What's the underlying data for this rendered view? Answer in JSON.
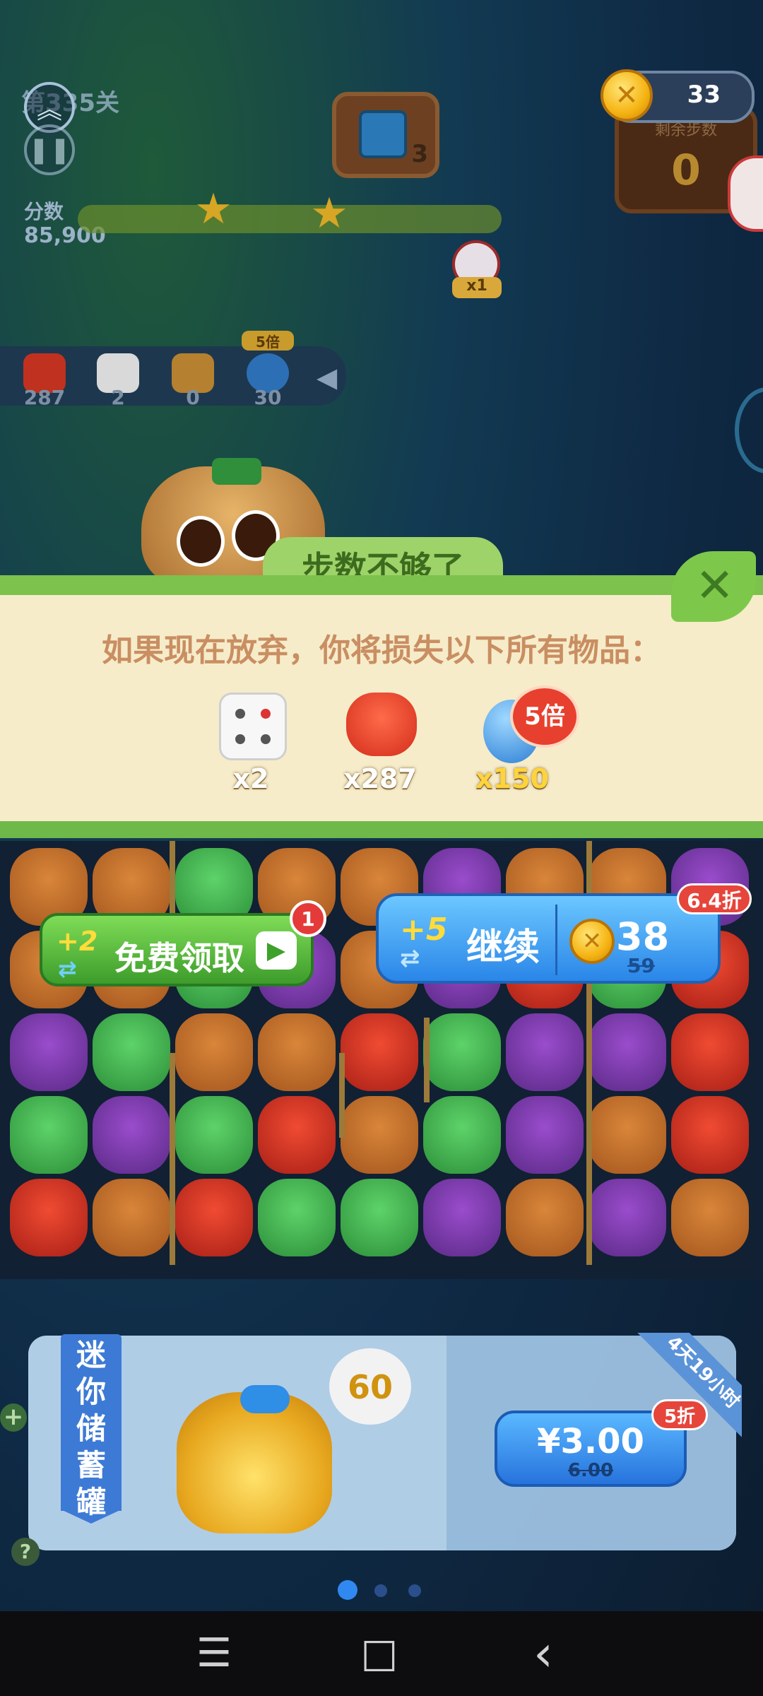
{
  "hud": {
    "level_text": "第335关",
    "score_label": "分数",
    "score_value": "85,900",
    "goal_count": "3",
    "coins": "33",
    "steps_label": "剩余步数",
    "steps_value": "0",
    "alarm_badge": "x1"
  },
  "boosters": [
    {
      "name": "fox-booster",
      "count": "287"
    },
    {
      "name": "dice-booster",
      "count": "2"
    },
    {
      "name": "bag-booster",
      "count": "0"
    },
    {
      "name": "drop-booster",
      "count": "30",
      "badge": "5倍"
    }
  ],
  "dialog": {
    "title": "步数不够了",
    "message": "如果现在放弃，你将损失以下所有物品：",
    "rewards": [
      {
        "icon": "dice-icon",
        "count": "x2"
      },
      {
        "icon": "fox-icon",
        "count": "x287"
      },
      {
        "icon": "water-drop-icon",
        "count": "x150",
        "badge": "5倍"
      }
    ]
  },
  "free_button": {
    "plus": "+2",
    "label": "免费领取",
    "notification": "1"
  },
  "continue_button": {
    "plus": "+5",
    "label": "继续",
    "price": "38",
    "original_price": "59",
    "discount": "6.4折"
  },
  "offer": {
    "title": "迷你储蓄罐",
    "bubble_value": "60",
    "price": "¥3.00",
    "original_price": "6.00",
    "discount": "5折",
    "timer": "4天19小时"
  },
  "nav": {
    "menu": "☰",
    "home": "□",
    "back": "‹"
  },
  "colors": {
    "primary_green": "#7cc24c",
    "primary_blue": "#2a86e8",
    "discount_red": "#e6453b"
  }
}
